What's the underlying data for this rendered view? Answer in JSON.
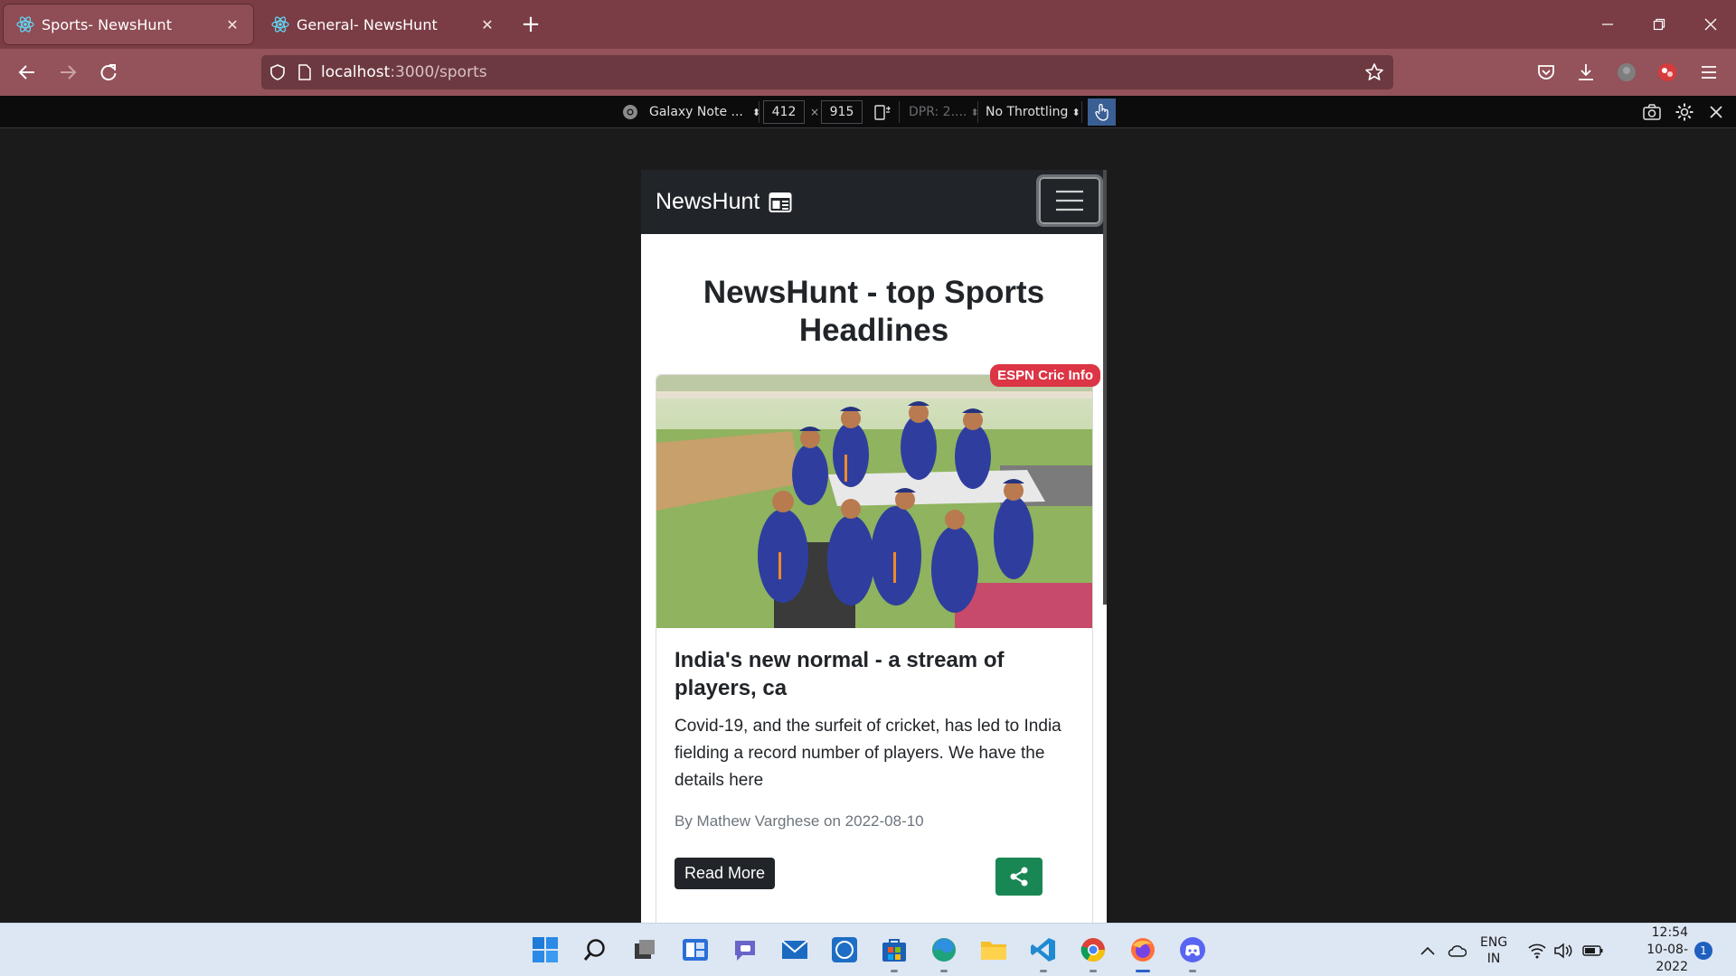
{
  "browser": {
    "tabs": [
      {
        "title": "Sports- NewsHunt",
        "active": true
      },
      {
        "title": "General- NewsHunt",
        "active": false
      }
    ],
    "url_host": "localhost",
    "url_path": ":3000/sports"
  },
  "rdm": {
    "device": "Galaxy Note ...",
    "width": "412",
    "times": "×",
    "height": "915",
    "dpr": "DPR: 2....",
    "throttling": "No Throttling"
  },
  "app": {
    "brand": "NewsHunt",
    "heading": "NewsHunt - top Sports Headlines",
    "article": {
      "source": "ESPN Cric Info",
      "title": "India's new normal - a stream of players, ca",
      "description": "Covid-19, and the surfeit of cricket, has led to India fielding a record number of players. We have the details here",
      "meta": "By Mathew Varghese on 2022-08-10",
      "read_more": "Read More"
    }
  },
  "taskbar": {
    "lang_top": "ENG",
    "lang_bottom": "IN",
    "time": "12:54",
    "date": "10-08-2022",
    "notifications": "1"
  },
  "colors": {
    "tabstrip": "#7a3d45",
    "toolbar": "#94525a",
    "badge": "#dc3545",
    "share": "#198754"
  }
}
